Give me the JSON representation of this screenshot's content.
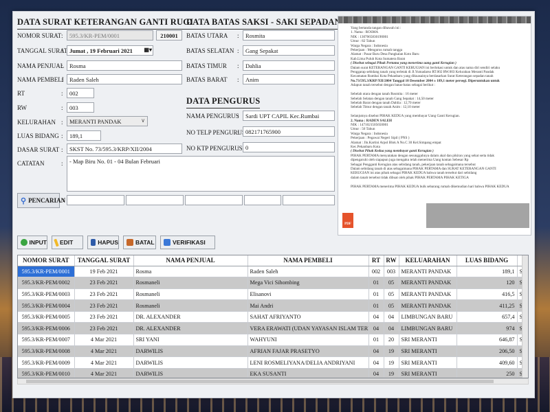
{
  "left": {
    "title": "DATA SURAT KETERANGAN GANTI RUGI",
    "fields": [
      {
        "label": "NOMOR SURAT",
        "value": "595.3/KR-PEM/0001",
        "code": "210001"
      },
      {
        "label": "TANGGAL SURAT",
        "value": "Jumat , 19  Februari  2021"
      },
      {
        "label": "NAMA PENJUAL",
        "value": "Rosma"
      },
      {
        "label": "NAMA PEMBELI",
        "value": "Raden Saleh"
      },
      {
        "label": "RT",
        "value": "002"
      },
      {
        "label": "RW",
        "value": "003"
      },
      {
        "label": "KELURAHAN",
        "value": "MERANTI PANDAK"
      },
      {
        "label": "LUAS BIDANG",
        "value": "189,1"
      },
      {
        "label": "DASAR SURAT",
        "value": "SKST No. 73/595.3/KRP/XII/2004"
      },
      {
        "label": "CATATAN",
        "value": "- Map Biru No. 01 - 04 Bulan Februari"
      }
    ]
  },
  "middle": {
    "title": "DATA BATAS SAKSI - SAKI SEPADAN",
    "fields": [
      {
        "label": "BATAS UTARA",
        "value": "Rosmita"
      },
      {
        "label": "BATAS SELATAN",
        "value": "Gang Sepakat"
      },
      {
        "label": "BATAS TIMUR",
        "value": "Dahlia"
      },
      {
        "label": "BATAS BARAT",
        "value": "Anim"
      }
    ],
    "pengurus_title": "DATA PENGURUS",
    "pengurus": [
      {
        "label": "NAMA PENGURUS",
        "value": "Sardi UPT CAPIL Kec.Rumbai"
      },
      {
        "label": "NO TELP PENGURUS",
        "value": "082171765900"
      },
      {
        "label": "NO KTP PENGURUS",
        "value": "0"
      }
    ]
  },
  "search": {
    "label": "PENCARIAN",
    "icon": "magnifier-icon"
  },
  "buttons": {
    "input": "INPUT",
    "edit": "EDIT",
    "hapus": "HAPUS",
    "batal": "BATAL",
    "verifikasi": "VERIFIKASI"
  },
  "doc": {
    "pdf_badge": "PDF",
    "lines": [
      {
        "t": "Yang bertanda tangan dibawah ini :",
        "s": ""
      },
      {
        "t": "   1.  Nama              :  ROSMA",
        "s": ""
      },
      {
        "t": "        NIK                :  1307065830190001",
        "s": ""
      },
      {
        "t": "        Umur              :  82 Tahun",
        "s": ""
      },
      {
        "t": "        Warga Negara  :  Indonesia",
        "s": ""
      },
      {
        "t": "        Pekerjaan        :  Mengurus rumah tangga",
        "s": ""
      },
      {
        "t": "        Alamat            :  Pasar Baru Desa Pangkalan Koto Baru",
        "s": ""
      },
      {
        "t": "                                Kab.Lima Puluh Kota Sumatera Barat",
        "s": ""
      },
      {
        "t": "          ( Disebut sebagai Pihak Pertama yang menerima uang ganti Kerugian )",
        "s": "i"
      },
      {
        "t": "Dalam surat KETERANGAN GANTI KERUGIAN ini berlokasi untuk dan atas nama diri sendiri selaku",
        "s": ""
      },
      {
        "t": "Penggarap sebidang tanah yang terletak di Jl.Yumadarso RT.002 RW.003 Kelurahan Meranti Pandak",
        "s": ""
      },
      {
        "t": "Kecamatan Rumbai Kota Pekanbaru yang dikuasainya berdasarkan Surat Keterangan sepadan tanah",
        "s": ""
      },
      {
        "t": "No.73/595.3/KRP/XII/2004 Tanggal 10 Desember 2004 ± 189,1 meter persegi. Diperuntukan untuk",
        "s": "b"
      },
      {
        "t": "Adapun tanah tersebut dengan batas-batas sebagai berikut :",
        "s": ""
      },
      {
        "t": "",
        "s": ""
      },
      {
        "t": "   Sebelah utara dengan tanah      Rosmita                           : 16        meter",
        "s": ""
      },
      {
        "t": "   Sebelah Selatan dengan tanah   Gang Sepakat                     : 14,50    meter",
        "s": ""
      },
      {
        "t": "   Sebelah Barat dengan tanah      Dahlia                             : 12,70    meter",
        "s": ""
      },
      {
        "t": "   Sebelah Timur dengan tanah      Anim                               : 12,10    meter",
        "s": ""
      },
      {
        "t": "",
        "s": ""
      },
      {
        "t": "Selanjutnya disebut PIHAK KEDUA yang membayar Uang Ganti Kerugian.",
        "s": ""
      },
      {
        "t": "   2.  Nama              :  RADEN SALEH",
        "s": "b"
      },
      {
        "t": "        NIK                :  1471021505650001",
        "s": ""
      },
      {
        "t": "        Umur              :  56 Tahun",
        "s": ""
      },
      {
        "t": "        Warga Negara  :  Indonesia",
        "s": ""
      },
      {
        "t": "        Pekerjaan        :  Pegawai Negeri Sipil ( PNS )",
        "s": ""
      },
      {
        "t": "        Alamat            :  Jln.Kartini Arpol Blok A No.C 30  Kel.Simpang empat",
        "s": ""
      },
      {
        "t": "                                Kec.Pekanbaru Kota",
        "s": ""
      },
      {
        "t": "            ( Disebut Pihak Kedua yang membayar ganti Kerugian )",
        "s": "i"
      },
      {
        "t": "PIHAK PERTAMA menyatakan dengan sesungguhnya dalam akal dan pikiran yang sehat serta tidak",
        "s": ""
      },
      {
        "t": "dipengaruhi oleh siapapun juga mengaku telah menerima Uang kontan Sebesar Rp",
        "s": ""
      },
      {
        "t": "Sebagai Pengganti Kerugian atas sebidang tanah, pekerjaan tanah sebagaimana tersebut",
        "s": ""
      },
      {
        "t": "Dalam sebidang tanah di atas sebagaimana PIHAK PERTAMA dan SURAT KETERANGAN GANTI",
        "s": ""
      },
      {
        "t": "KERUGIAN ini atas pihak sebagai PIHAK KEDUA bahwa tanah tersebut dari sebidang",
        "s": ""
      },
      {
        "t": "dalam tanah tersebut tidak dibuat oleh pihak PIHAK PERTAMA PIHAK KETIGA",
        "s": ""
      },
      {
        "t": "",
        "s": ""
      },
      {
        "t": "PIHAK PERTAMA menerima PIHAK KEDUA bulk sebarang rumah dikemudian hari bahwa PIHAK KEDUA",
        "s": ""
      }
    ]
  },
  "table": {
    "columns": [
      "NOMOR SURAT",
      "TANGGAL SURAT",
      "NAMA PENJUAL",
      "NAMA PEMBELI",
      "RT",
      "RW",
      "KELUARAHAN",
      "LUAS BIDANG",
      ""
    ],
    "rows": [
      [
        "595.3/KR-PEM/0001",
        "19 Feb 2021",
        "Rosma",
        "Raden Saleh",
        "002",
        "003",
        "MERANTI PANDAK",
        "189,1",
        "SKST"
      ],
      [
        "595.3/KR-PEM/0002",
        "23 Feb 2021",
        "Rosmaneli",
        "Mega Vici Sihombing",
        "01",
        "05",
        "MERANTI PANDAK",
        "120",
        "SPST"
      ],
      [
        "595.3/KR-PEM/0003",
        "23 Feb 2021",
        "Rosmaneli",
        "Elisanovi",
        "01",
        "05",
        "MERANTI PANDAK",
        "416,5",
        "SPST"
      ],
      [
        "595.3/KR-PEM/0004",
        "23 Feb 2021",
        "Rosmaneli",
        "Mai Andri",
        "01",
        "05",
        "MERANTI PANDAK",
        "411,25",
        "SPST"
      ],
      [
        "595.3/KR-PEM/0005",
        "23 Feb 2021",
        "DR. ALEXANDER",
        "SAHAT AFRIYANTO",
        "04",
        "04",
        "LIMBUNGAN BARU",
        "657,4",
        "SKST"
      ],
      [
        "595.3/KR-PEM/0006",
        "23 Feb 2021",
        "DR. ALEXANDER",
        "VERA ERAWATI (UDAN YAYASAN ISLAM TERPAD...",
        "04",
        "04",
        "LIMBUNGAN BARU",
        "974",
        "SKST"
      ],
      [
        "595.3/KR-PEM/0007",
        "4 Mar 2021",
        "SRI YANI",
        "WAHYUNI",
        "01",
        "20",
        "SRI MERANTI",
        "646,87",
        "SPGI"
      ],
      [
        "595.3/KR-PEM/0008",
        "4 Mar 2021",
        "DARWILIS",
        "AFRIAN FAJAR PRASETYO",
        "04",
        "19",
        "SRI MERANTI",
        "206,50",
        "SPST"
      ],
      [
        "595.3/KR-PEM/0009",
        "4 Mar 2021",
        "DARWILIS",
        "LENI ROSMELIYANA/DELIA ANDRIYANI",
        "04",
        "19",
        "SRI MERANTI",
        "409,60",
        "SPST"
      ],
      [
        "595.3/KR-PEM/0010",
        "4 Mar 2021",
        "DARWILIS",
        "EKA SUSANTI",
        "04",
        "19",
        "SRI MERANTI",
        "250",
        "SPST"
      ]
    ]
  }
}
